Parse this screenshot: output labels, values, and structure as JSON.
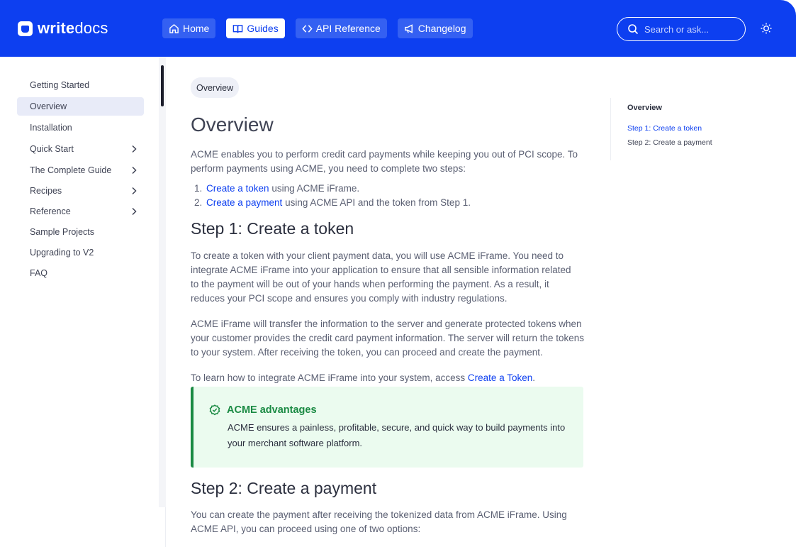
{
  "brand": {
    "name_bold": "write",
    "name_light": "docs"
  },
  "nav": {
    "items": [
      {
        "label": "Home",
        "icon": "home-icon",
        "active": false
      },
      {
        "label": "Guides",
        "icon": "book-icon",
        "active": true
      },
      {
        "label": "API Reference",
        "icon": "code-icon",
        "active": false
      },
      {
        "label": "Changelog",
        "icon": "megaphone-icon",
        "active": false
      }
    ]
  },
  "search": {
    "placeholder": "Search or ask..."
  },
  "sidebar": {
    "items": [
      {
        "label": "Getting Started"
      },
      {
        "label": "Overview"
      },
      {
        "label": "Installation"
      },
      {
        "label": "Quick Start"
      },
      {
        "label": "The Complete Guide"
      },
      {
        "label": "Recipes"
      },
      {
        "label": "Reference"
      },
      {
        "label": "Sample Projects"
      },
      {
        "label": "Upgrading to V2"
      },
      {
        "label": "FAQ"
      }
    ]
  },
  "main": {
    "breadcrumb": "Overview",
    "title": "Overview",
    "intro": "ACME enables you to perform credit card payments while keeping you out of PCI scope. To perform payments using ACME, you need to complete two steps:",
    "steps": [
      {
        "num": "1.",
        "link": "Create a token",
        "rest": " using ACME iFrame."
      },
      {
        "num": "2.",
        "link": "Create a payment",
        "rest": " using ACME API and the token from Step 1."
      }
    ],
    "step1_heading": "Step 1: Create a token",
    "step1_p1": "To create a token with your client payment data, you will use ACME iFrame. You need to integrate ACME iFrame into your application to ensure that all sensible information related to the payment will be out of your hands when performing the payment. As a result, it reduces your PCI scope and ensures you comply with industry regulations.",
    "step1_p2": "ACME iFrame will transfer the information to the server and generate protected tokens when your customer provides the credit card payment information. The server will return the tokens to your system. After receiving the token, you can proceed and create the payment.",
    "step1_p3_text": "To learn how to integrate ACME iFrame into your system, access ",
    "step1_p3_link": "Create a Token",
    "step1_p3_end": ".",
    "callout": {
      "title": "ACME advantages",
      "text": "ACME ensures a painless, profitable, secure, and quick way to build payments into your merchant software platform.",
      "accent": "#1a8a43"
    },
    "step2_heading": "Step 2: Create a payment",
    "step2_p1": "You can create the payment after receiving the tokenized data from ACME iFrame. Using ACME API, you can proceed using one of two options:"
  },
  "toc": {
    "title": "Overview",
    "items": [
      {
        "label": "Step 1: Create a token"
      },
      {
        "label": "Step 2: Create a payment"
      }
    ]
  },
  "colors": {
    "brand": "#0d3ff0",
    "callout_bg": "#ebfbef"
  }
}
